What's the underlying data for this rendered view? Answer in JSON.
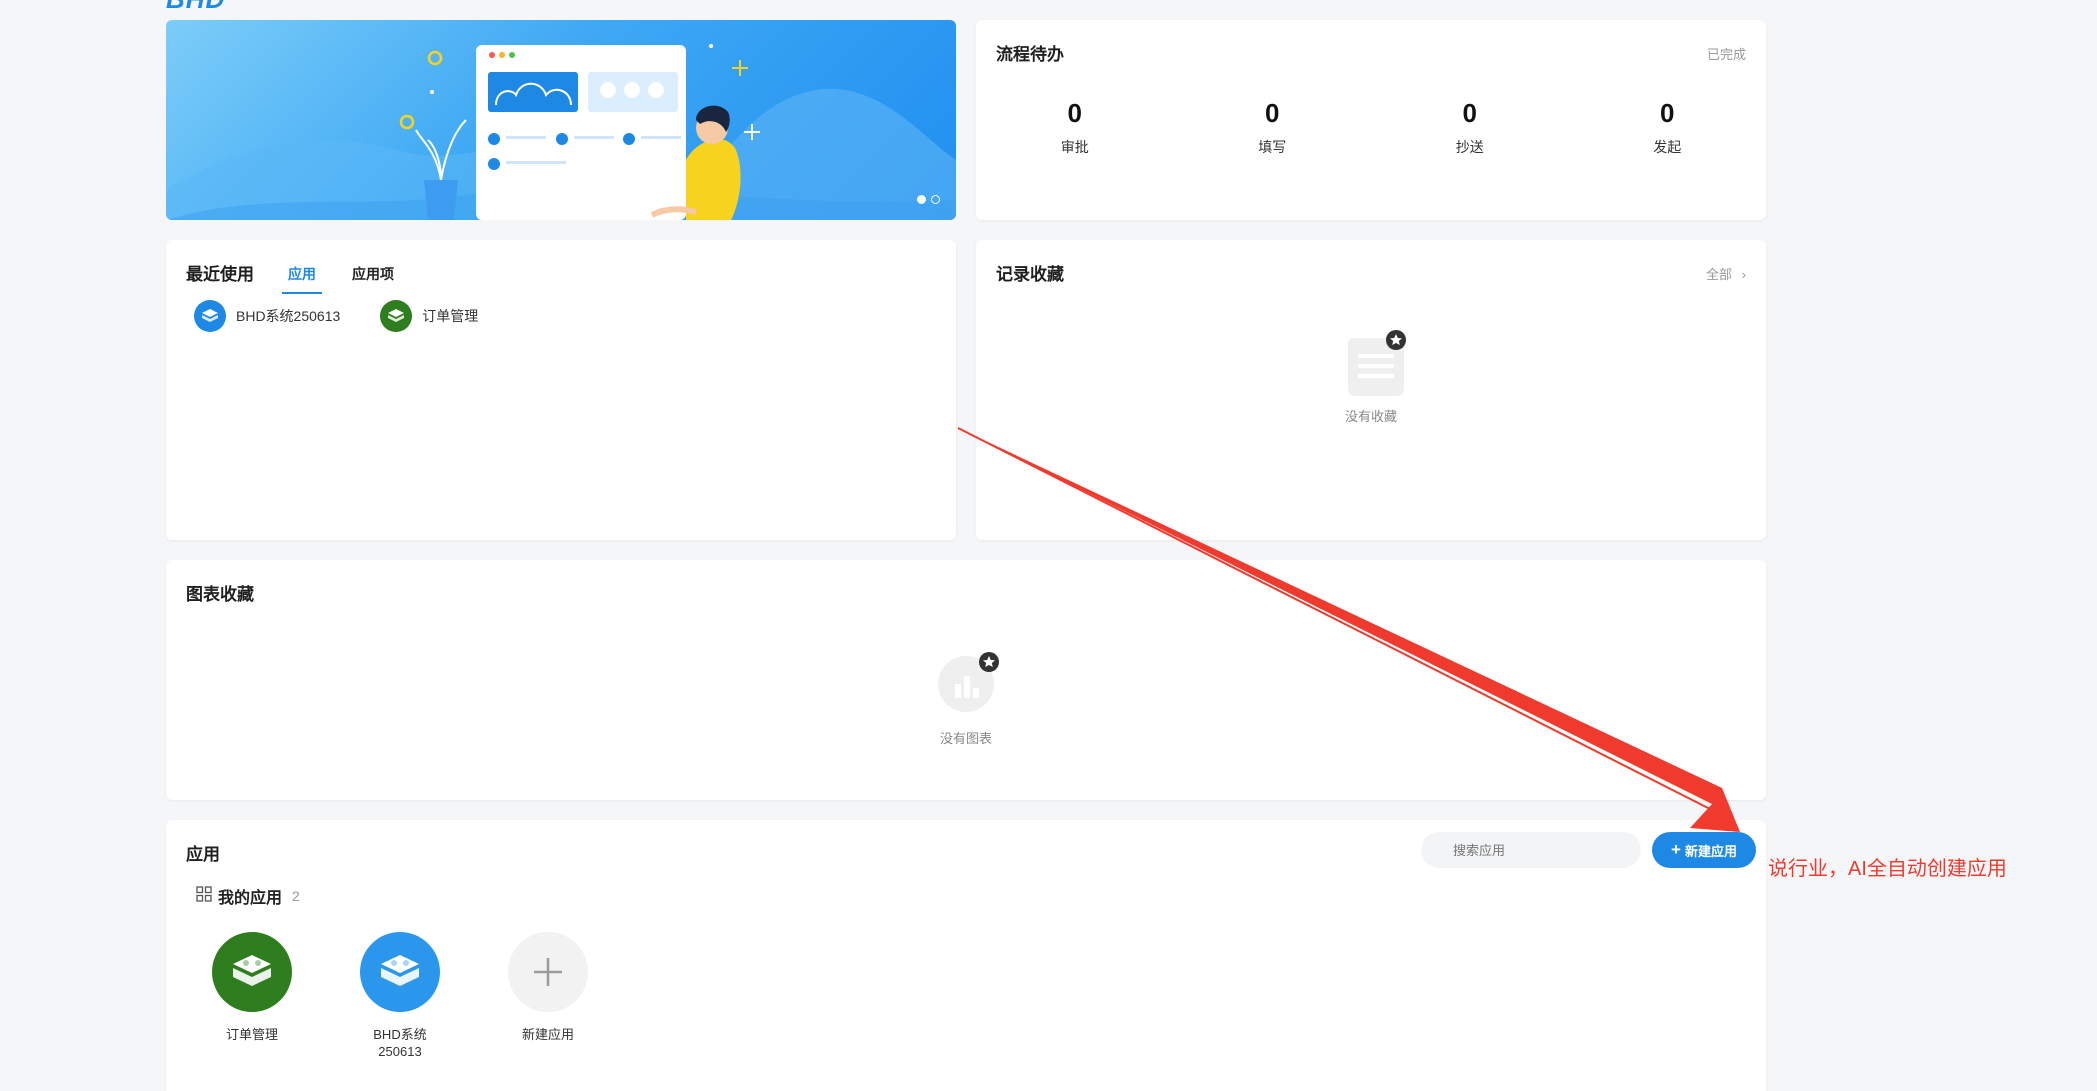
{
  "logo_text": "BHD",
  "banner": {
    "slides": 2,
    "active_slide": 1
  },
  "process": {
    "title": "流程待办",
    "link": "已完成",
    "stats": [
      {
        "value": "0",
        "label": "审批"
      },
      {
        "value": "0",
        "label": "填写"
      },
      {
        "value": "0",
        "label": "抄送"
      },
      {
        "value": "0",
        "label": "发起"
      }
    ]
  },
  "recent": {
    "title": "最近使用",
    "tabs": [
      "应用",
      "应用项"
    ],
    "active_tab": 0,
    "items": [
      {
        "name": "BHD系统250613",
        "color": "#1e88e5"
      },
      {
        "name": "订单管理",
        "color": "#2e7d1e"
      }
    ]
  },
  "records": {
    "title": "记录收藏",
    "link": "全部",
    "empty_text": "没有收藏"
  },
  "charts": {
    "title": "图表收藏",
    "empty_text": "没有图表"
  },
  "apps": {
    "title": "应用",
    "search_placeholder": "搜索应用",
    "new_button": "新建应用",
    "my_apps_label": "我的应用",
    "my_apps_count": "2",
    "tiles": [
      {
        "name": "订单管理",
        "color": "#2e7d1e"
      },
      {
        "name": "BHD系统\n250613",
        "color": "#2b97ec"
      },
      {
        "name": "新建应用",
        "color": "#f2f2f2"
      }
    ]
  },
  "annotation": "说行业，AI全自动创建应用",
  "colors": {
    "accent": "#1e88e5",
    "annotation_red": "#f03a2e"
  }
}
